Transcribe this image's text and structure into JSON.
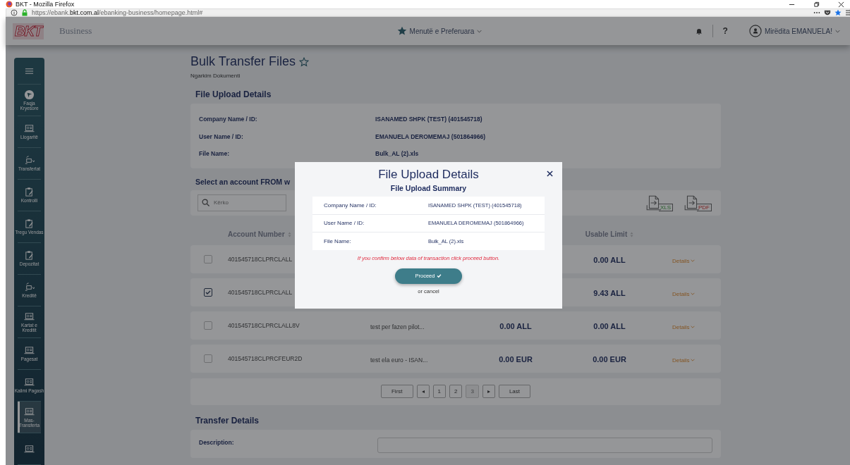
{
  "window": {
    "title": "BKT - Mozilla Firefox"
  },
  "address_bar": {
    "url": "https://ebank.**bkt.com.al**/ebanking-business/homepage.html#"
  },
  "header": {
    "logo": "BKT",
    "product": "Business",
    "favorites": "Menutë e Preferuara",
    "help": "?",
    "greeting": "Mirëdita EMANUELA!"
  },
  "sidebar": {
    "items": [
      {
        "label": "Faqja Kryesore",
        "kind": "home",
        "selected": false
      },
      {
        "label": "Llogaritë",
        "kind": "laptop",
        "selected": false
      },
      {
        "label": "Transfertat",
        "kind": "transfer",
        "selected": false
      },
      {
        "label": "Kontrolli",
        "kind": "clipboard",
        "selected": false
      },
      {
        "label": "Tregu Vendas",
        "kind": "clipboard",
        "selected": false
      },
      {
        "label": "Depozitat",
        "kind": "clipboard",
        "selected": false
      },
      {
        "label": "Kreditë",
        "kind": "transfer",
        "selected": false
      },
      {
        "label": "Kartat e Kreditit",
        "kind": "laptop",
        "selected": false
      },
      {
        "label": "Pagesat",
        "kind": "laptop",
        "selected": false
      },
      {
        "label": "Kalimi Pagash",
        "kind": "laptop",
        "selected": false
      },
      {
        "label": "Mas-Transferta",
        "kind": "laptop",
        "selected": true
      },
      {
        "kind": "laptop",
        "selected": false
      }
    ]
  },
  "page": {
    "title": "Bulk Transfer Files",
    "subtitle": "Ngarkim Dokumenti",
    "file_details": {
      "heading": "File Upload Details",
      "rows": [
        {
          "label": "Company Name / ID:",
          "value": "ISANAMED SHPK (TEST) (401545718)"
        },
        {
          "label": "User Name / ID:",
          "value": "EMANUELA DEROMEMAJ (501864966)"
        },
        {
          "label": "File Name:",
          "value": "Bulk_AL (2).xls"
        }
      ]
    },
    "accounts": {
      "heading": "Select an account FROM w",
      "search": {
        "placeholder": "Kërko"
      },
      "exports": [
        {
          "label": "XLS",
          "kind": "xls"
        },
        {
          "label": "PDF",
          "kind": "pdf"
        }
      ],
      "columns": [
        "Account Number",
        "Usable Limit"
      ],
      "rows": [
        {
          "checked": false,
          "account": "401545718CLPRCLALL",
          "usable_limit": "0.00 ALL",
          "details": "Details"
        },
        {
          "checked": true,
          "account": "401545718CLPRCLALL",
          "usable_limit": "9.43 ALL",
          "details": "Details"
        },
        {
          "checked": false,
          "account": "401545718CLPRCLALL8V",
          "description": "test per fazen pilot...",
          "balance": "0.00 ALL",
          "usable_limit": "0.00 ALL",
          "details": "Details"
        },
        {
          "checked": false,
          "account": "401545718CLPRCFEUR2D",
          "description": "test ela euro - ISAN...",
          "balance": "0.00 EUR",
          "usable_limit": "0.00 EUR",
          "details": "Details"
        }
      ],
      "pagination": [
        {
          "label": "First",
          "disabled": false
        },
        {
          "label": "◂",
          "disabled": false
        },
        {
          "label": "1",
          "disabled": false
        },
        {
          "label": "2",
          "disabled": false
        },
        {
          "label": "3",
          "disabled": true
        },
        {
          "label": "▸",
          "disabled": false
        },
        {
          "label": "Last",
          "disabled": false
        }
      ]
    },
    "transfer_details": {
      "heading": "Transfer Details",
      "description_label": "Description:"
    }
  },
  "modal": {
    "title": "File Upload Details",
    "subtitle": "File Upload Summary",
    "rows": [
      {
        "label": "Company Name / ID:",
        "value": "ISANAMED SHPK (TEST) (401545718)"
      },
      {
        "label": "User Name / ID:",
        "value": "EMANUELA DEROMEMAJ (501864966)"
      },
      {
        "label": "File Name:",
        "value": "Bulk_AL (2).xls"
      }
    ],
    "warning": "If you confirm below data of transaction click proceed button.",
    "proceed": "Proceed",
    "cancel": "or cancel"
  }
}
